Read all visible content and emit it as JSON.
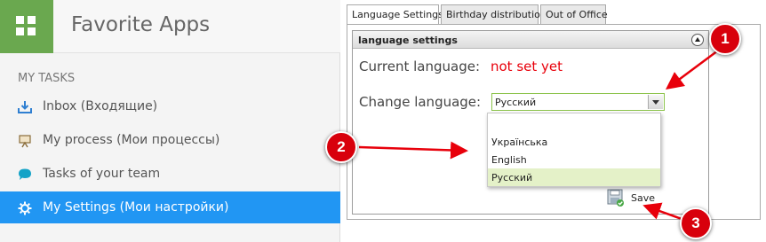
{
  "sidebar": {
    "app_title": "Favorite Apps",
    "section_title": "MY TASKS",
    "items": [
      {
        "label": "Inbox (Входящие)",
        "icon": "inbox-icon",
        "active": false
      },
      {
        "label": "My process (Мои процессы)",
        "icon": "presentation-icon",
        "active": false
      },
      {
        "label": "Tasks of your team",
        "icon": "chat-bubble-icon",
        "active": false
      },
      {
        "label": "My Settings (Мои настройки)",
        "icon": "gear-icon",
        "active": true
      }
    ]
  },
  "tabs": [
    "Language Settings",
    "Birthday distribution",
    "Out of Office"
  ],
  "panel": {
    "title": "language settings",
    "current_language_label": "Current language:",
    "current_language_value": "not set yet",
    "change_language_label": "Change language:",
    "selected_value": "Русский",
    "options": [
      "",
      "Українська",
      "English",
      "Русский"
    ],
    "save_label": "Save"
  },
  "annotations": [
    "1",
    "2",
    "3"
  ],
  "colors": {
    "accent_blue": "#2196f3",
    "tile_green": "#6aa84f",
    "warning_red": "#e8000b",
    "badge_red": "#d8000c",
    "select_border": "#8bc34a",
    "option_highlight": "#e4f1c8"
  }
}
